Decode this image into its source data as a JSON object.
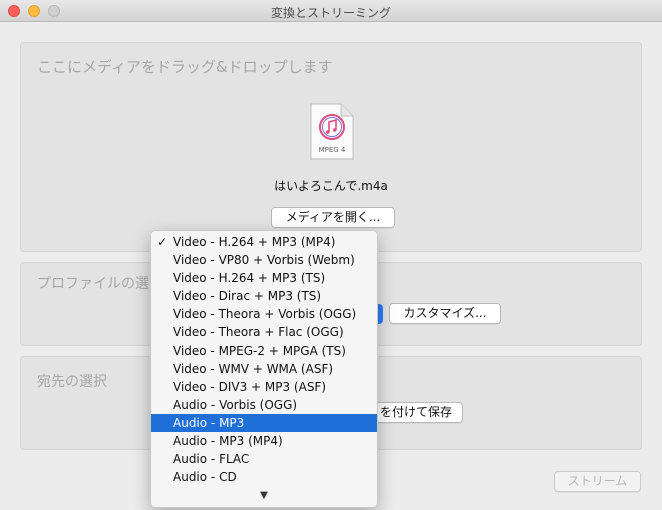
{
  "window": {
    "title": "変換とストリーミング"
  },
  "drop_panel": {
    "label": "ここにメディアをドラッグ&ドロップします",
    "file_type_label": "MPEG 4",
    "file_name": "はいよろこんで.m4a",
    "open_button": "メディアを開く..."
  },
  "profile_panel": {
    "label": "プロファイルの選",
    "customize_button": "カスタマイズ..."
  },
  "destination_panel": {
    "label": "宛先の選択",
    "save_button": "を付けて保存"
  },
  "stream_button": "ストリーム",
  "profile_menu": {
    "checkmark": "✓",
    "scroll_arrow": "▼",
    "selected_index": 10,
    "items": [
      "Video - H.264 + MP3 (MP4)",
      "Video - VP80 + Vorbis (Webm)",
      "Video - H.264 + MP3 (TS)",
      "Video - Dirac + MP3 (TS)",
      "Video - Theora + Vorbis (OGG)",
      "Video - Theora + Flac (OGG)",
      "Video - MPEG-2 + MPGA (TS)",
      "Video - WMV + WMA (ASF)",
      "Video - DIV3 + MP3 (ASF)",
      "Audio - Vorbis (OGG)",
      "Audio - MP3",
      "Audio - MP3 (MP4)",
      "Audio - FLAC",
      "Audio - CD"
    ]
  },
  "colors": {
    "selection": "#1f6fd8",
    "close": "#fc605c",
    "minimize": "#fdbc40"
  }
}
